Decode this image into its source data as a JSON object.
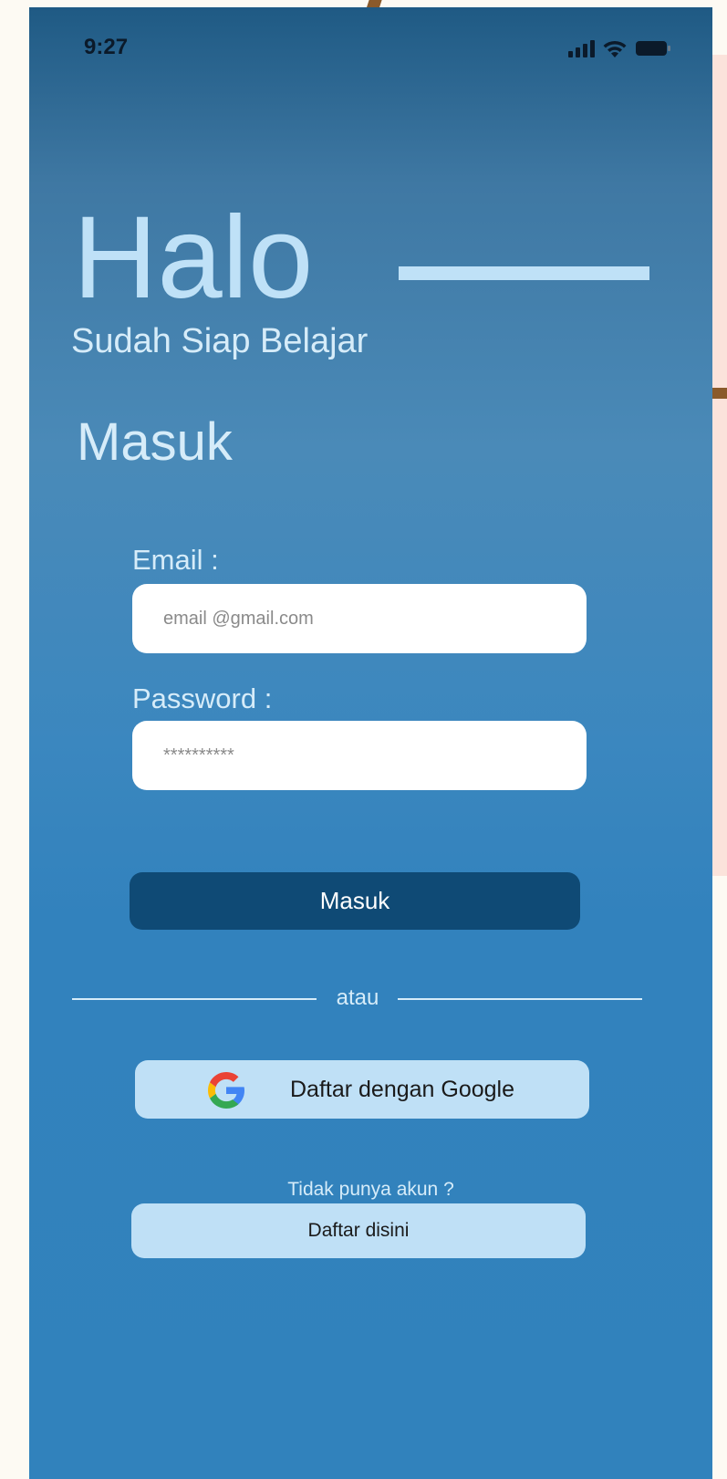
{
  "status_bar": {
    "time": "9:27",
    "icons": [
      "signal-icon",
      "wifi-icon",
      "battery-icon"
    ]
  },
  "hero": {
    "title": "Halo",
    "subtitle": "Sudah Siap Belajar"
  },
  "login": {
    "heading": "Masuk",
    "email_label": "Email :",
    "email_placeholder": "email @gmail.com",
    "password_label": "Password :",
    "password_placeholder": "**********",
    "submit_label": "Masuk"
  },
  "divider": {
    "text": "atau"
  },
  "google": {
    "label": "Daftar dengan Google",
    "icon": "google-icon"
  },
  "register": {
    "prompt": "Tidak punya akun ?",
    "button_label": "Daftar disini"
  },
  "colors": {
    "primary_dark": "#0f4a75",
    "light_blue": "#bfe0f6",
    "text_light": "#d6ecf9"
  }
}
